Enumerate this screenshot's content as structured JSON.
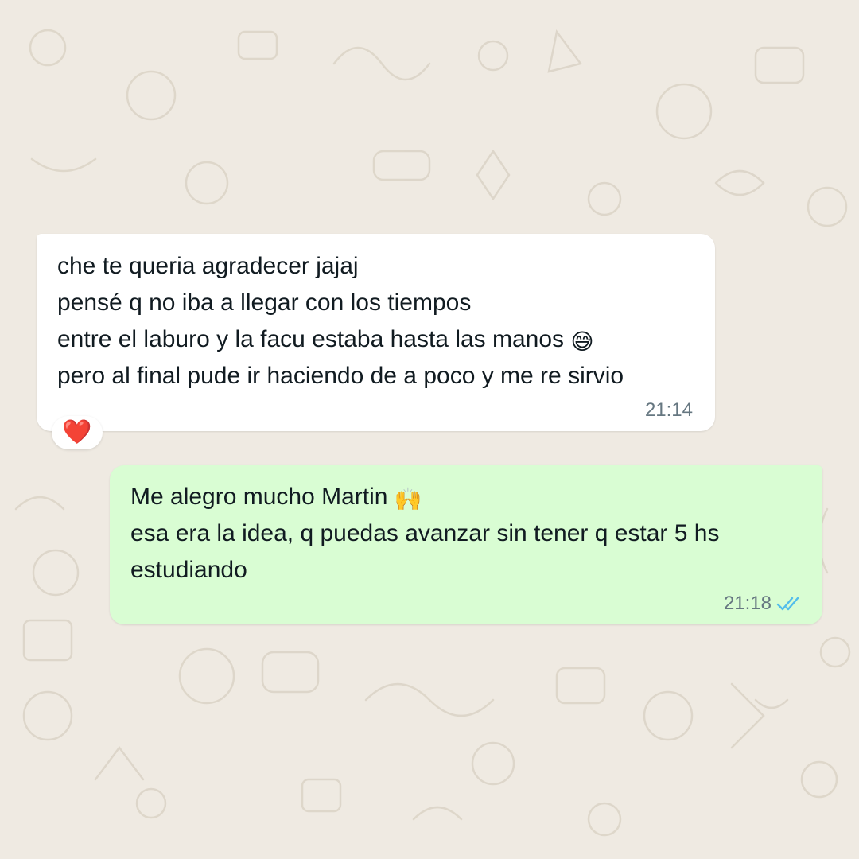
{
  "theme": {
    "chat_background": "#efeae2",
    "incoming_bubble": "#ffffff",
    "outgoing_bubble": "#d9fdd3",
    "text_color": "#111b21",
    "meta_color": "#667781",
    "read_tick_color": "#53bdeb"
  },
  "messages": {
    "incoming": {
      "lines": [
        "che te queria agradecer jajaj",
        "pensé q no iba a llegar con los tiempos",
        "entre el laburo y la facu estaba hasta las manos",
        "pero al final pude ir haciendo de a poco y me re sirvio"
      ],
      "line3_emoji": "😅",
      "time": "21:14",
      "reaction": "❤️"
    },
    "outgoing": {
      "lines": [
        "Me alegro mucho Martin",
        "esa era la idea, q puedas avanzar sin tener q estar 5 hs",
        "estudiando"
      ],
      "line1_emoji": "🙌",
      "time": "21:18",
      "status_icon": "double-check-read-icon"
    }
  }
}
